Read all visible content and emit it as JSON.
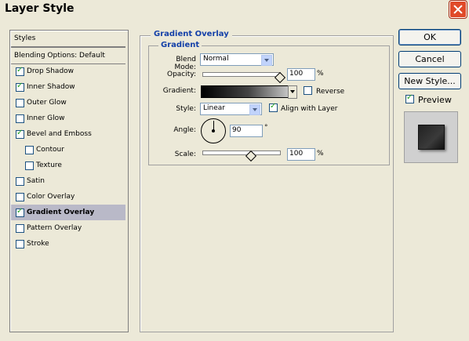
{
  "window": {
    "title": "Layer Style"
  },
  "styles_panel": {
    "header": "Styles",
    "blending_options": "Blending Options: Default",
    "items": [
      {
        "label": "Drop Shadow",
        "checked": true
      },
      {
        "label": "Inner Shadow",
        "checked": true
      },
      {
        "label": "Outer Glow",
        "checked": false
      },
      {
        "label": "Inner Glow",
        "checked": false
      },
      {
        "label": "Bevel and Emboss",
        "checked": true
      },
      {
        "label": "Contour",
        "checked": false
      },
      {
        "label": "Texture",
        "checked": false
      },
      {
        "label": "Satin",
        "checked": false
      },
      {
        "label": "Color Overlay",
        "checked": false
      },
      {
        "label": "Gradient Overlay",
        "checked": true
      },
      {
        "label": "Pattern Overlay",
        "checked": false
      },
      {
        "label": "Stroke",
        "checked": false
      }
    ],
    "active": "Gradient Overlay"
  },
  "gradient_overlay": {
    "section_title": "Gradient Overlay",
    "subsection_title": "Gradient",
    "blend_mode_label": "Blend Mode:",
    "blend_mode_value": "Normal",
    "opacity_label": "Opacity:",
    "opacity_value": "100",
    "opacity_unit": "%",
    "gradient_label": "Gradient:",
    "reverse_label": "Reverse",
    "reverse_checked": false,
    "style_label": "Style:",
    "style_value": "Linear",
    "align_label": "Align with Layer",
    "align_checked": true,
    "angle_label": "Angle:",
    "angle_value": "90",
    "angle_unit": "°",
    "scale_label": "Scale:",
    "scale_value": "100",
    "scale_unit": "%"
  },
  "buttons": {
    "ok": "OK",
    "cancel": "Cancel",
    "new_style": "New Style..."
  },
  "preview": {
    "label": "Preview",
    "checked": true
  },
  "colors": {
    "section_title": "#1440a8",
    "active_row": "#b9b9c8",
    "dialog_bg": "#ece9d8"
  }
}
